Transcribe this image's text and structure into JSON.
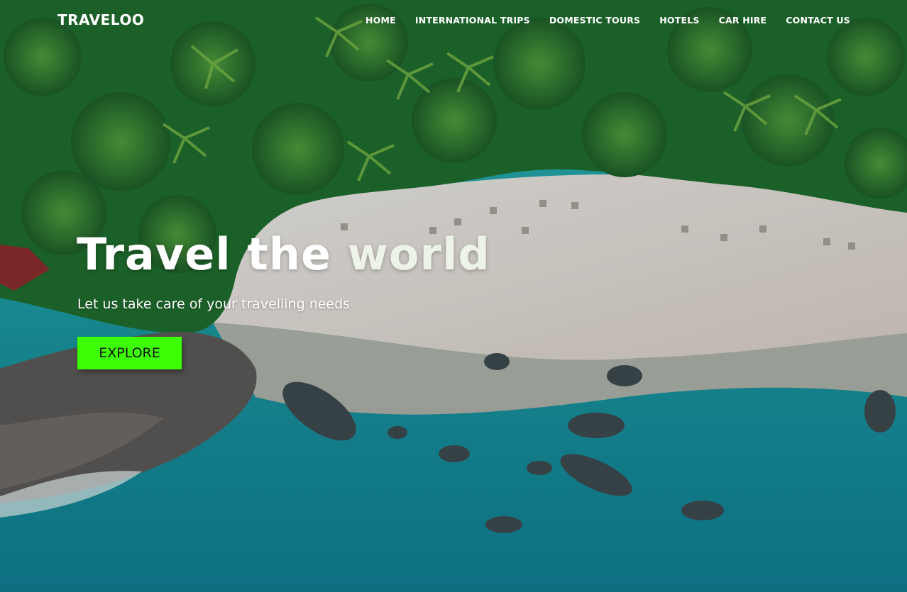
{
  "brand": {
    "logo": "TRAVELOO"
  },
  "nav": {
    "items": [
      "HOME",
      "INTERNATIONAL TRIPS",
      "DOMESTIC TOURS",
      "HOTELS",
      "CAR HIRE",
      "CONTACT US"
    ]
  },
  "hero": {
    "title_part1": "Travel the",
    "title_part2": "world",
    "subtitle": "Let us take care of your travelling needs",
    "cta_label": "EXPLORE",
    "background": "aerial-beach-photo"
  },
  "colors": {
    "cta": "#3cff05",
    "text": "#ffffff",
    "forest": "#1f6e2e",
    "sand": "#e6e2dc",
    "sea": "#1fa8a8"
  }
}
